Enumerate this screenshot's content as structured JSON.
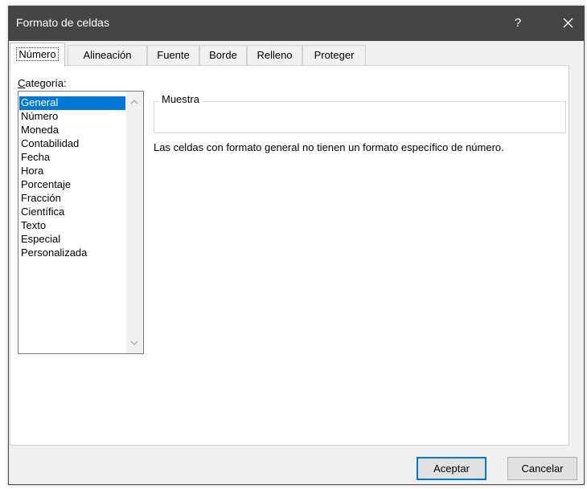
{
  "window": {
    "title": "Formato de celdas",
    "help_label": "?"
  },
  "tabs": [
    {
      "label": "Número",
      "active": true
    },
    {
      "label": "Alineación"
    },
    {
      "label": "Fuente"
    },
    {
      "label": "Borde"
    },
    {
      "label": "Relleno"
    },
    {
      "label": "Proteger"
    }
  ],
  "category": {
    "label_first": "C",
    "label_rest": "ategoría:",
    "items": [
      "General",
      "Número",
      "Moneda",
      "Contabilidad",
      "Fecha",
      "Hora",
      "Porcentaje",
      "Fracción",
      "Científica",
      "Texto",
      "Especial",
      "Personalizada"
    ],
    "selected": "General"
  },
  "sample": {
    "legend": "Muestra",
    "value": ""
  },
  "description": "Las celdas con formato general no tienen un formato específico de número.",
  "buttons": {
    "ok": "Aceptar",
    "cancel": "Cancelar"
  },
  "colors": {
    "titlebar": "#454545",
    "selection": "#0078d7",
    "dialog_bg": "#f0f0f0"
  },
  "icons": {
    "help": "question-mark",
    "close": "close-icon",
    "scroll_up": "chevron-up-icon",
    "scroll_down": "chevron-down-icon"
  }
}
